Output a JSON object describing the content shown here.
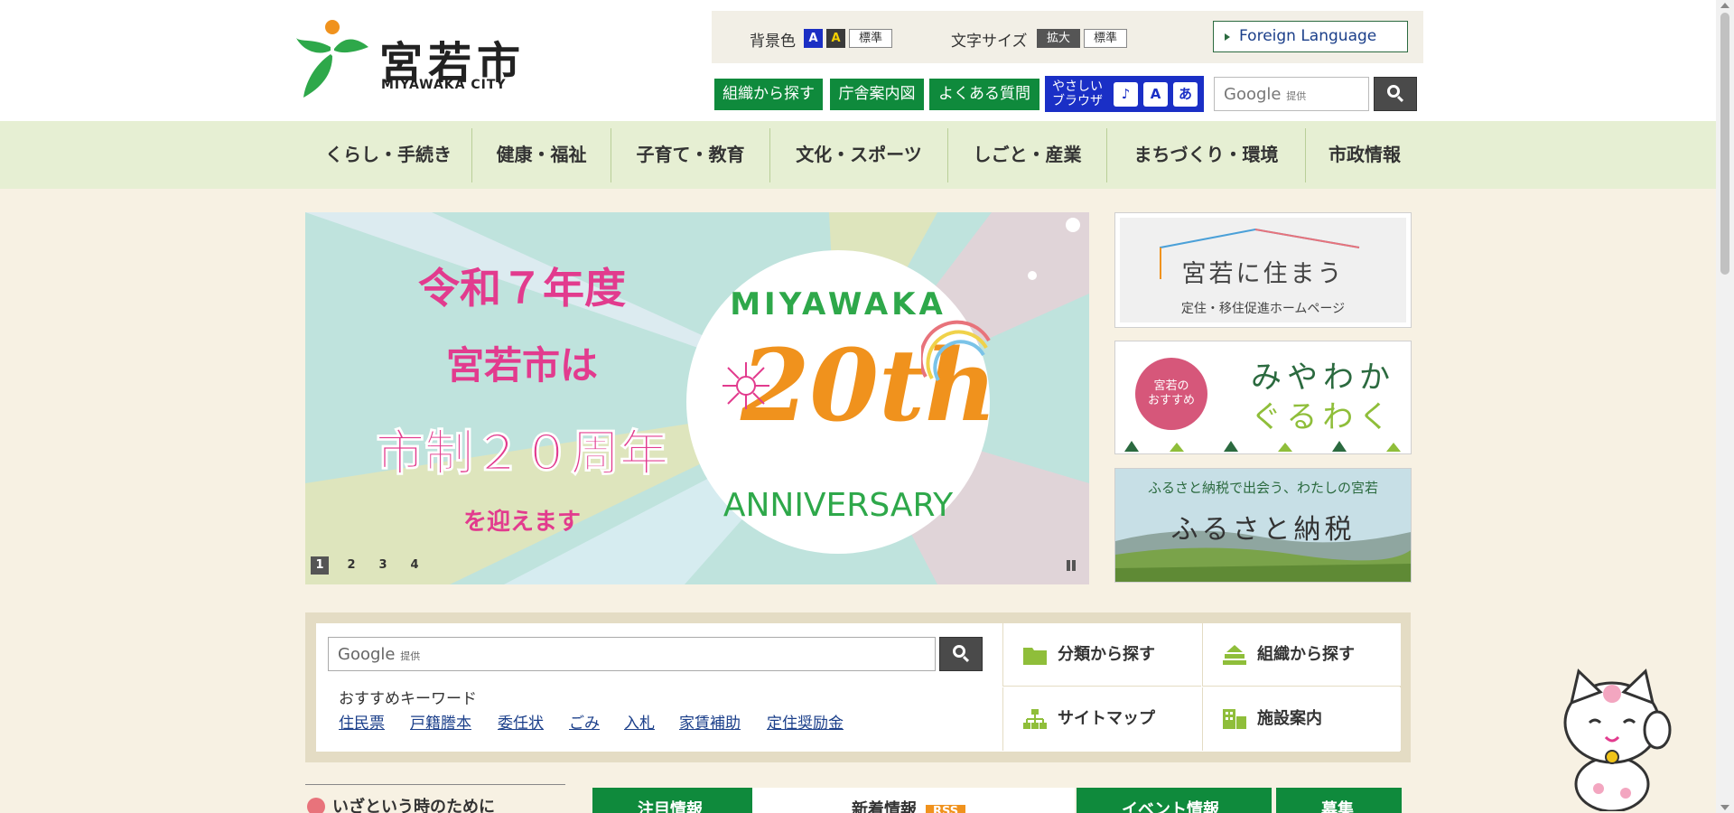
{
  "header": {
    "logo_title": "宮若市",
    "logo_sub": "MIYAWAKA CITY",
    "bg_color_label": "背景色",
    "bg_blue": "A",
    "bg_yellow": "A",
    "bg_default": "標準",
    "font_size_label": "文字サイズ",
    "font_enlarge": "拡大",
    "font_default": "標準",
    "foreign_language": "Foreign Language",
    "quick_links": [
      "組織から探す",
      "庁舎案内図",
      "よくある質問"
    ],
    "yasashii_browser": "やさしい\nブラウザ",
    "search_placeholder": "Google",
    "search_provided": "提供"
  },
  "nav": {
    "items": [
      "くらし・手続き",
      "健康・福祉",
      "子育て・教育",
      "文化・スポーツ",
      "しごと・産業",
      "まちづくり・環境",
      "市政情報"
    ]
  },
  "slider": {
    "line1": "令和７年度",
    "line2": "宮若市は",
    "line3": "市制２０周年",
    "line4": "を迎えます",
    "circle_top": "MIYAWAKA",
    "circle_number": "20th",
    "circle_bottom": "ANNIVERSARY",
    "pages": [
      "1",
      "2",
      "3",
      "4"
    ],
    "active_page": "1"
  },
  "banners": {
    "b1_title": "宮若に住まう",
    "b1_sub": "定住・移住促進ホームページ",
    "b2_badge": "宮若の\nおすすめ",
    "b2_title_1": "みやわか",
    "b2_title_2": "ぐるわく",
    "b3_sub": "ふるさと納税で出会う、わたしの宮若",
    "b3_title": "ふるさと納税"
  },
  "search_panel": {
    "placeholder": "Google",
    "provided": "提供",
    "keywords_label": "おすすめキーワード",
    "keywords": [
      "住民票",
      "戸籍謄本",
      "委任状",
      "ごみ",
      "入札",
      "家賃補助",
      "定住奨励金"
    ],
    "cells": [
      "分類から探す",
      "組織から探す",
      "サイトマップ",
      "施設案内"
    ]
  },
  "bottom": {
    "emergency": "いざという時のために",
    "tabs": [
      "注目情報",
      "新着情報",
      "イベント情報",
      "募集"
    ],
    "rss": "RSS"
  },
  "colors": {
    "brand_green": "#0f8a3c",
    "nav_bg": "#e6efd3",
    "accent_pink": "#e23b8e",
    "accent_orange": "#f0921d"
  }
}
